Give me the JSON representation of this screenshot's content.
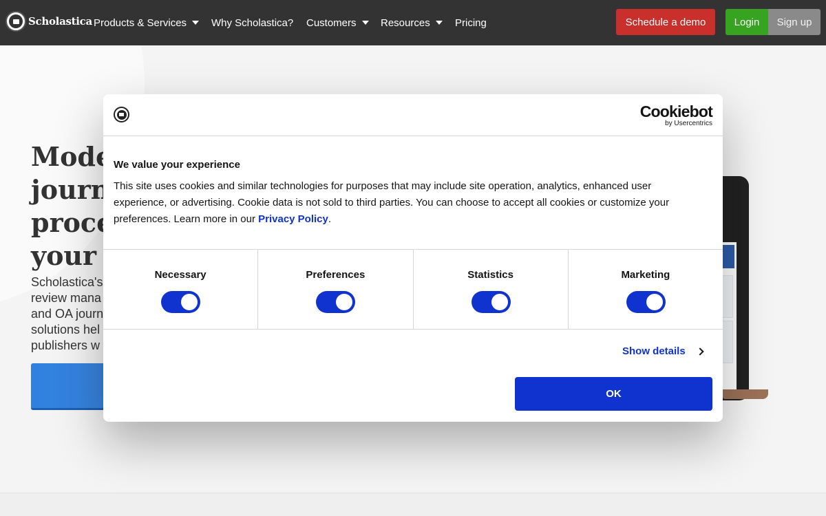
{
  "nav": {
    "logo_text": "Scholastica",
    "items": [
      {
        "label": "Products & Services",
        "has_dropdown": true
      },
      {
        "label": "Why Scholastica?",
        "has_dropdown": false
      },
      {
        "label": "Customers",
        "has_dropdown": true
      },
      {
        "label": "Resources",
        "has_dropdown": true
      },
      {
        "label": "Pricing",
        "has_dropdown": false
      }
    ],
    "demo_label": "Schedule a demo",
    "login_label": "Login",
    "signup_label": "Sign up"
  },
  "hero": {
    "title_lines": [
      "Moder",
      "journa",
      "proce",
      "your n"
    ],
    "desc_lines": [
      "Scholastica's",
      "review mana",
      "and OA journ",
      "solutions hel",
      "publishers w"
    ]
  },
  "cookie_dialog": {
    "brand_name": "Cookiebot",
    "brand_sub": "by Usercentrics",
    "title": "We value your experience",
    "body_lines": [
      "This site uses cookies and similar technologies for purposes that may include site operation, analytics, enhanced user",
      "experience, or advertising. Cookie data is not sold to third parties. You can choose to accept all cookies or customize your",
      "preferences. Learn more in our"
    ],
    "privacy_link": "Privacy Policy",
    "body_end": ".",
    "toggles": [
      {
        "label": "Necessary",
        "checked": true
      },
      {
        "label": "Preferences",
        "checked": true
      },
      {
        "label": "Statistics",
        "checked": true
      },
      {
        "label": "Marketing",
        "checked": true
      }
    ],
    "show_details_label": "Show details",
    "ok_label": "OK"
  },
  "colors": {
    "nav_bg": "#333333",
    "demo_button": "#c9302c",
    "login_button": "#36a420",
    "signup_button": "#8a8a8a",
    "cookiebot_accent": "#1032cf",
    "hero_cta": "#2f80e0"
  }
}
